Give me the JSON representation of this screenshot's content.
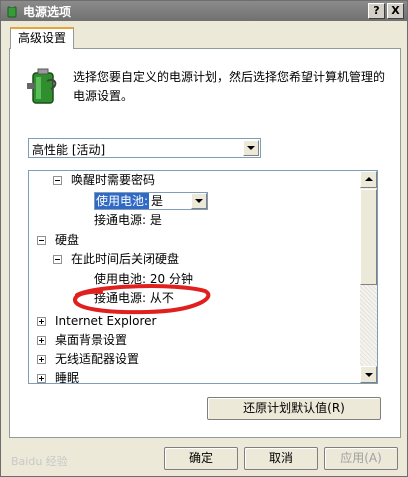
{
  "window": {
    "title": "电源选项",
    "help_label": "?",
    "close_label": "X"
  },
  "tab": {
    "label": "高级设置"
  },
  "description": "选择您要自定义的电源计划，然后选择您希望计算机管理的电源设置。",
  "plan_select": {
    "value": "高性能 [活动]"
  },
  "tree": {
    "items": [
      {
        "label": "唤醒时需要密码",
        "expander": "minus"
      },
      {
        "label": "使用电池:",
        "value": "是",
        "editing": true
      },
      {
        "label": "接通电源: 是"
      },
      {
        "label": "硬盘",
        "expander": "minus"
      },
      {
        "label": "在此时间后关闭硬盘",
        "expander": "minus"
      },
      {
        "label": "使用电池: 20 分钟"
      },
      {
        "label": "接通电源: 从不"
      },
      {
        "label": "Internet Explorer",
        "expander": "plus"
      },
      {
        "label": "桌面背景设置",
        "expander": "plus"
      },
      {
        "label": "无线适配器设置",
        "expander": "plus"
      },
      {
        "label": "睡眠",
        "expander": "plus"
      }
    ]
  },
  "buttons": {
    "restore": "还原计划默认值(R)",
    "ok": "确定",
    "cancel": "取消",
    "apply": "应用(A)"
  },
  "watermark": "Baidu 经验",
  "annotation_color": "#e0201e"
}
